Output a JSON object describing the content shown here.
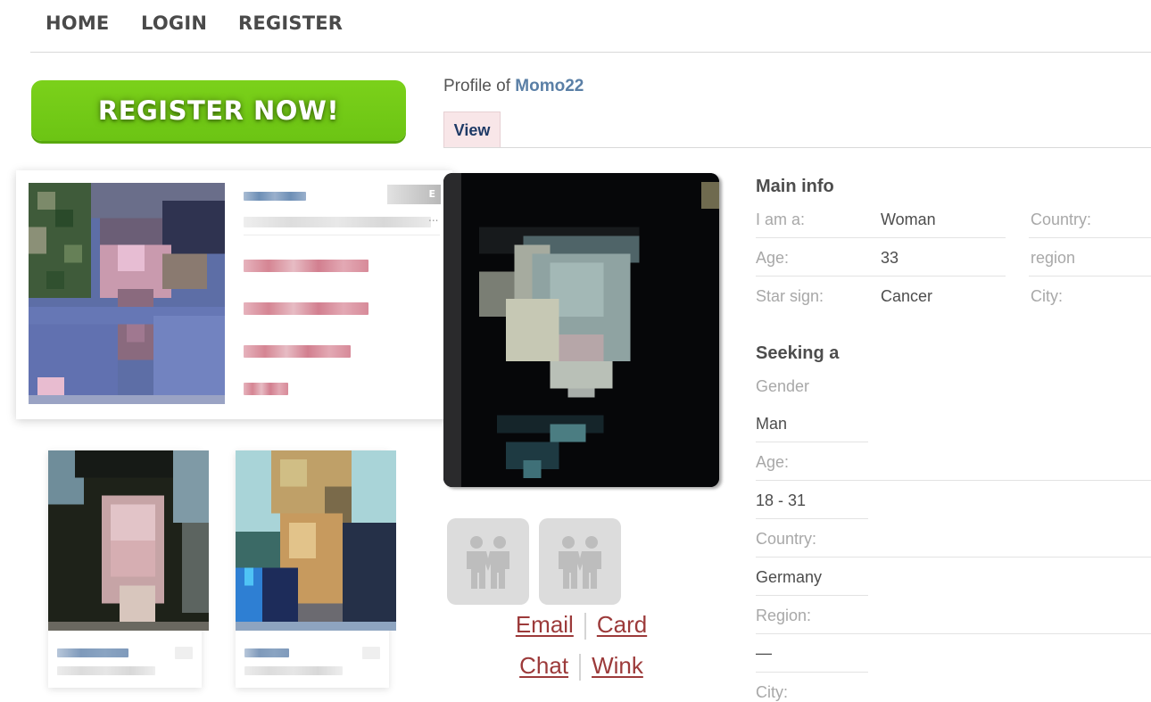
{
  "nav": {
    "items": [
      {
        "label": "HOME"
      },
      {
        "label": "LOGIN"
      },
      {
        "label": "REGISTER"
      }
    ]
  },
  "cta": {
    "register_now_label": "REGISTER NOW!",
    "color": "#6fc615"
  },
  "featured_member": {
    "badge_text": "E",
    "more_indicator": "..."
  },
  "profile": {
    "title_prefix": "Profile of",
    "username": "Momo22",
    "tabs": [
      {
        "label": "View",
        "active": true
      }
    ]
  },
  "actions": {
    "email": "Email",
    "card": "Card",
    "chat": "Chat",
    "wink": "Wink",
    "link_color": "#9c3a3a"
  },
  "main_info": {
    "title": "Main info",
    "rows": [
      {
        "label": "I am a:",
        "value": "Woman"
      },
      {
        "label": "Age:",
        "value": "33"
      },
      {
        "label": "Star sign:",
        "value": "Cancer"
      }
    ],
    "location_labels": [
      "Country:",
      "region",
      "City:"
    ]
  },
  "seeking": {
    "title": "Seeking a",
    "fields": [
      {
        "label": "Gender",
        "value": "Man"
      },
      {
        "label": "Age:",
        "value": "18 - 31"
      },
      {
        "label": "Country:",
        "value": "Germany"
      },
      {
        "label": "Region:",
        "value": "—"
      },
      {
        "label": "City:",
        "value": ""
      }
    ]
  }
}
